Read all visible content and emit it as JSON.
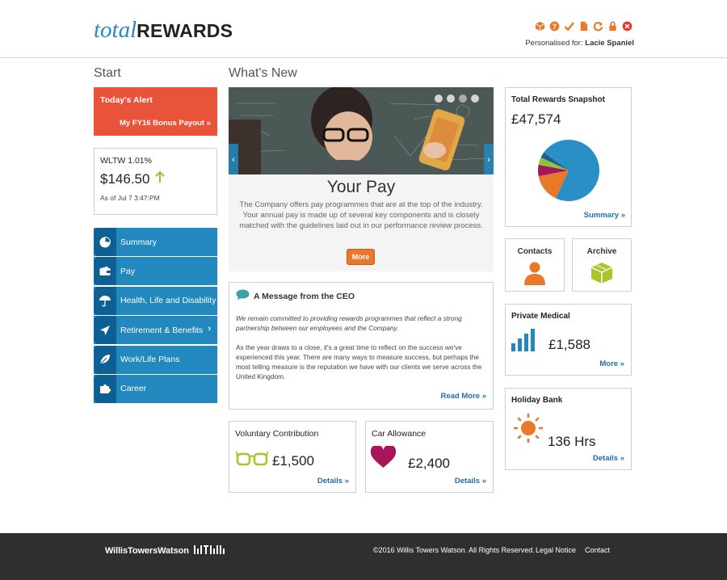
{
  "header": {
    "logo_light": "total",
    "logo_bold": "REWARDS",
    "personalised_label": "Personalised for:",
    "user_name": "Lacie Spaniel",
    "colors": {
      "logo_blue": "#2a87b8",
      "tool_orange": "#e8782a",
      "tool_red": "#e03a2b"
    },
    "tools": [
      "box-icon",
      "help-icon",
      "check-icon",
      "document-icon",
      "refresh-icon",
      "lock-icon",
      "close-icon"
    ]
  },
  "sections": {
    "start": "Start",
    "whats_new": "What's New"
  },
  "alert": {
    "title": "Today's Alert",
    "link": "My FY16 Bonus Payout",
    "color": "#e8533a"
  },
  "stock": {
    "name": "WLTW 1.01%",
    "price": "$146.50",
    "date": "As of Jul 7 3:47:PM"
  },
  "nav": [
    {
      "label": "Summary",
      "icon": "pie-chart-icon"
    },
    {
      "label": "Pay",
      "icon": "wallet-icon"
    },
    {
      "label": "Health, Life and Disability",
      "icon": "umbrella-icon"
    },
    {
      "label": "Retirement & Benefits",
      "icon": "paper-plane-icon",
      "arrow": "›"
    },
    {
      "label": "Work/Life Plans",
      "icon": "leaf-icon"
    },
    {
      "label": "Career",
      "icon": "puzzle-icon"
    }
  ],
  "hero": {
    "title": "Your Pay",
    "text": "The Company offers pay programmes that are at the top of the industry. Your annual pay is made up of several key components and is closely matched with the guidelines laid out in our performance review process.",
    "button": "More",
    "slides": 4,
    "active_slide": 3
  },
  "ceo": {
    "title": "A Message from the CEO",
    "para1": "We remain committed to providing rewards programmes that reflect a strong partnership between our employees and the Company.",
    "para2": "As the year draws to a close, it's a great time to reflect on the success we've experienced this year. There are many ways to measure success, but perhaps the most telling measure is the reputation we have with our clients we serve across the United Kingdom.",
    "link": "Read More"
  },
  "voluntary": {
    "title": "Voluntary Contribution",
    "value": "£1,500",
    "link": "Details"
  },
  "car": {
    "title": "Car Allowance",
    "value": "£2,400",
    "link": "Details"
  },
  "snapshot": {
    "title": "Total Rewards Snapshot",
    "value": "£47,574",
    "link": "Summary",
    "pie": [
      {
        "value": 0.72,
        "color": "#2a8fc5"
      },
      {
        "value": 0.15,
        "color": "#e8782a"
      },
      {
        "value": 0.06,
        "color": "#a7165a"
      },
      {
        "value": 0.04,
        "color": "#8bc53f"
      },
      {
        "value": 0.03,
        "color": "#1e5f8c"
      }
    ]
  },
  "contacts": {
    "title": "Contacts"
  },
  "archive": {
    "title": "Archive"
  },
  "medical": {
    "title": "Private Medical",
    "value": "£1,588",
    "link": "More"
  },
  "holiday": {
    "title": "Holiday Bank",
    "value": "136 Hrs",
    "link": "Details"
  },
  "footer": {
    "brand": "WillisTowersWatson",
    "copyright": "©2016 Willis Towers Watson. All Rights Reserved.",
    "legal": "Legal Notice",
    "contact": "Contact"
  }
}
